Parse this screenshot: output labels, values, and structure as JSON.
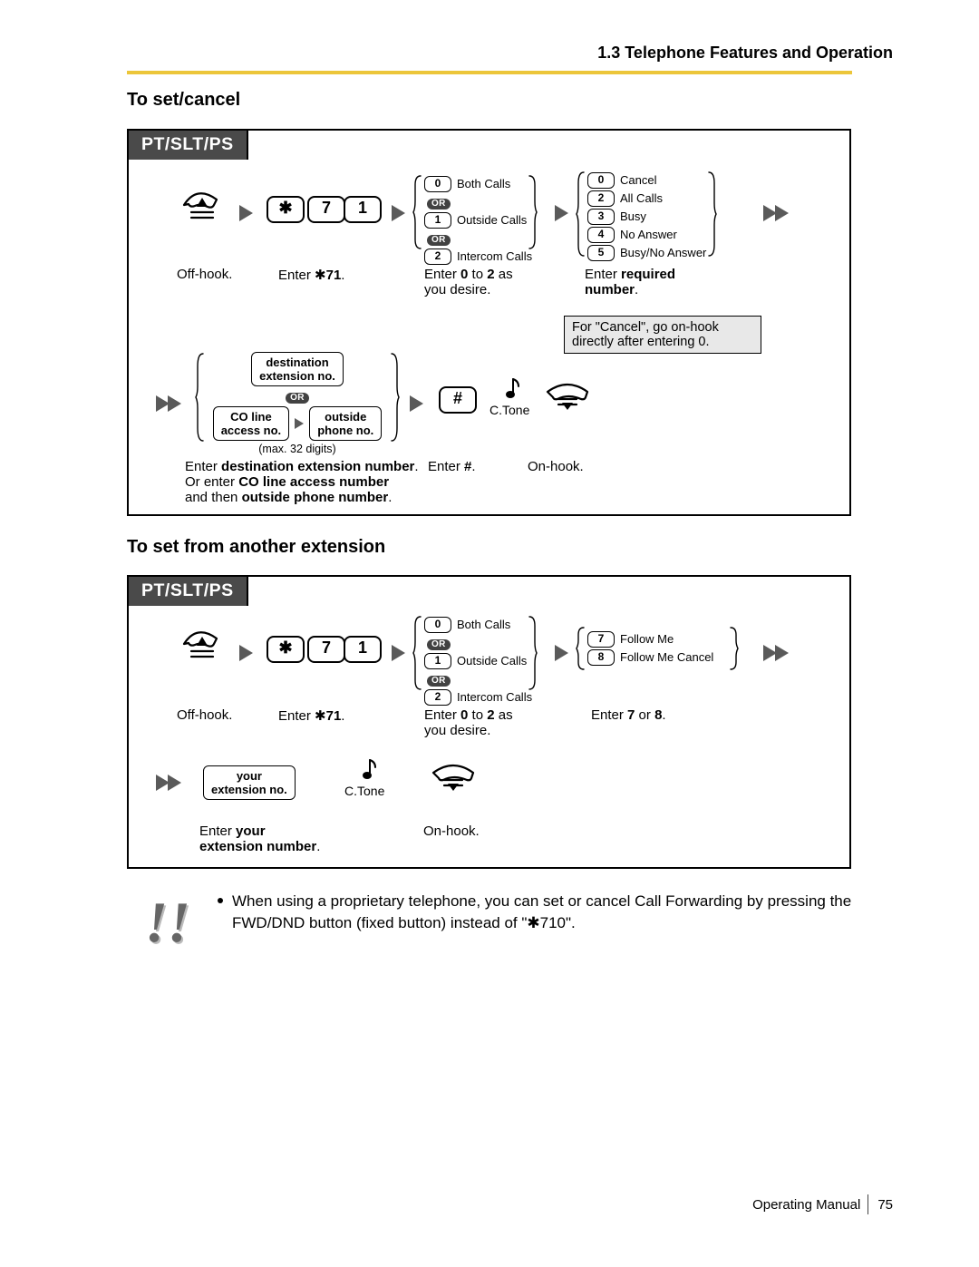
{
  "header": "1.3 Telephone Features and Operation",
  "section1": {
    "title": "To set/cancel",
    "tab": "PT/SLT/PS",
    "step_offhook": "Off-hook.",
    "step_enter71_pre": "Enter ",
    "step_enter71_code": "71",
    "step_enter71_post": ".",
    "keys": {
      "star": "✱",
      "k7": "7",
      "k1": "1",
      "hash": "#"
    },
    "group_calltype": {
      "options": [
        {
          "key": "0",
          "label": "Both Calls"
        },
        {
          "key": "1",
          "label": "Outside Calls"
        },
        {
          "key": "2",
          "label": "Intercom Calls"
        }
      ],
      "or": "OR",
      "caption_line1_a": "Enter ",
      "caption_line1_b": "0",
      "caption_line1_c": " to ",
      "caption_line1_d": "2",
      "caption_line1_e": " as",
      "caption_line2": "you desire."
    },
    "group_fwdtype": {
      "options": [
        {
          "key": "0",
          "label": "Cancel"
        },
        {
          "key": "2",
          "label": "All Calls"
        },
        {
          "key": "3",
          "label": "Busy"
        },
        {
          "key": "4",
          "label": "No Answer"
        },
        {
          "key": "5",
          "label": "Busy/No Answer"
        }
      ],
      "caption_a": "Enter ",
      "caption_b": "required",
      "caption_c": "number",
      "caption_d": "."
    },
    "cancel_note_l1": "For \"Cancel\", go on-hook",
    "cancel_note_l2": "directly after entering 0.",
    "dest": {
      "box1_l1": "destination",
      "box1_l2": "extension no.",
      "or": "OR",
      "box2_l1": "CO line",
      "box2_l2": "access no.",
      "box3_l1": "outside",
      "box3_l2": "phone no.",
      "max": "(max. 32 digits)",
      "cap_l1_a": "Enter ",
      "cap_l1_b": "destination extension number",
      "cap_l1_c": ".",
      "cap_l2_a": "Or enter ",
      "cap_l2_b": "CO line access number",
      "cap_l3_a": "and then ",
      "cap_l3_b": "outside phone number",
      "cap_l3_c": "."
    },
    "enter_hash_a": "Enter ",
    "enter_hash_b": "#",
    "enter_hash_c": ".",
    "ctone": "C.Tone",
    "onhook": "On-hook."
  },
  "section2": {
    "title": "To set from another extension",
    "tab": "PT/SLT/PS",
    "step_offhook": "Off-hook.",
    "step_enter71_pre": "Enter ",
    "step_enter71_code": "71",
    "step_enter71_post": ".",
    "keys": {
      "star": "✱",
      "k7": "7",
      "k1": "1"
    },
    "group_calltype": {
      "options": [
        {
          "key": "0",
          "label": "Both Calls"
        },
        {
          "key": "1",
          "label": "Outside Calls"
        },
        {
          "key": "2",
          "label": "Intercom Calls"
        }
      ],
      "or": "OR",
      "caption_line1_a": "Enter ",
      "caption_line1_b": "0",
      "caption_line1_c": " to ",
      "caption_line1_d": "2",
      "caption_line1_e": " as",
      "caption_line2": "you desire."
    },
    "group_follow": {
      "options": [
        {
          "key": "7",
          "label": "Follow Me"
        },
        {
          "key": "8",
          "label": "Follow Me Cancel"
        }
      ],
      "caption_a": "Enter ",
      "caption_b": "7",
      "caption_c": " or ",
      "caption_d": "8",
      "caption_e": "."
    },
    "yourext_box_l1": "your",
    "yourext_box_l2": "extension no.",
    "yourext_cap_l1_a": "Enter ",
    "yourext_cap_l1_b": "your",
    "yourext_cap_l2": "extension number",
    "yourext_cap_l2_post": ".",
    "ctone": "C.Tone",
    "onhook": "On-hook."
  },
  "note": {
    "bang": "!!",
    "line1": "When using a proprietary telephone, you can set or cancel Call Forwarding by pressing the",
    "line2_a": "FWD/DND button (fixed button) instead of \"",
    "line2_star": "✱",
    "line2_b": "710\"."
  },
  "footer": {
    "manual": "Operating Manual",
    "page": "75"
  }
}
